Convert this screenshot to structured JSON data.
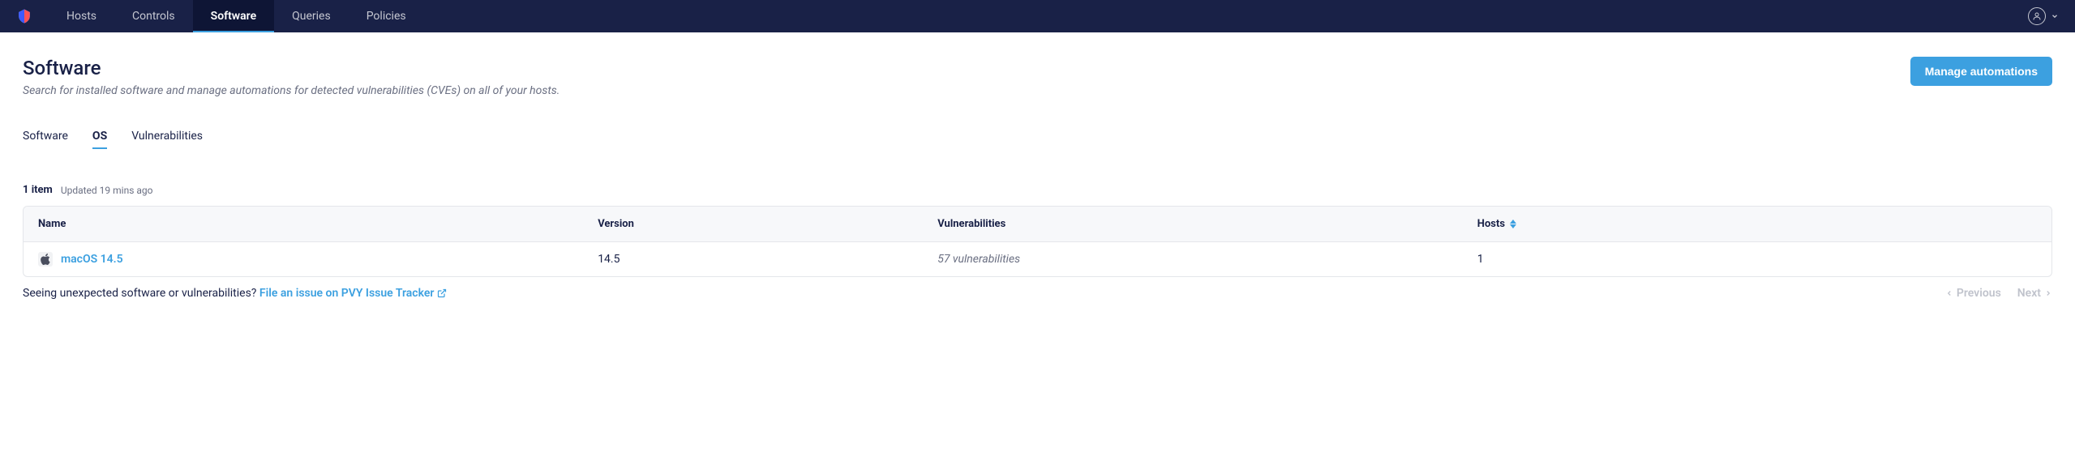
{
  "nav": {
    "items": [
      "Hosts",
      "Controls",
      "Software",
      "Queries",
      "Policies"
    ],
    "active": "Software"
  },
  "header": {
    "title": "Software",
    "subtitle": "Search for installed software and manage automations for detected vulnerabilities (CVEs) on all of your hosts.",
    "button": "Manage automations"
  },
  "tabs": {
    "items": [
      "Software",
      "OS",
      "Vulnerabilities"
    ],
    "active": "OS"
  },
  "meta": {
    "count": "1 item",
    "updated": "Updated 19 mins ago"
  },
  "table": {
    "columns": {
      "name": "Name",
      "version": "Version",
      "vulnerabilities": "Vulnerabilities",
      "hosts": "Hosts"
    },
    "rows": [
      {
        "name": "macOS 14.5",
        "version": "14.5",
        "vulnerabilities": "57 vulnerabilities",
        "hosts": "1"
      }
    ]
  },
  "footer": {
    "prompt": "Seeing unexpected software or vulnerabilities? ",
    "link": "File an issue on PVY Issue Tracker",
    "prev": "Previous",
    "next": "Next"
  }
}
